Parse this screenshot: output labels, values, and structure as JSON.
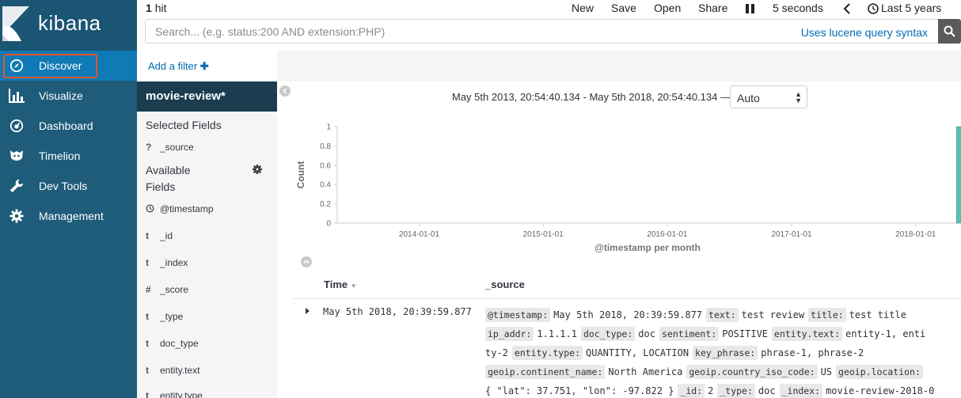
{
  "app": {
    "name": "kibana"
  },
  "nav": {
    "items": [
      {
        "label": "Discover",
        "icon": "compass-icon",
        "active": true
      },
      {
        "label": "Visualize",
        "icon": "bar-chart-icon"
      },
      {
        "label": "Dashboard",
        "icon": "dashboard-icon"
      },
      {
        "label": "Timelion",
        "icon": "timelion-icon"
      },
      {
        "label": "Dev Tools",
        "icon": "wrench-icon"
      },
      {
        "label": "Management",
        "icon": "gear-icon"
      }
    ]
  },
  "topbar": {
    "hits_count": "1",
    "hits_label": "hit",
    "menu": [
      "New",
      "Save",
      "Open",
      "Share"
    ],
    "refresh_interval": "5 seconds",
    "time_range_label": "Last 5 years"
  },
  "search": {
    "placeholder": "Search... (e.g. status:200 AND extension:PHP)",
    "value": "",
    "syntax_link": "Uses lucene query syntax"
  },
  "filter": {
    "add_label": "Add a filter"
  },
  "sidebar": {
    "index_pattern": "movie-review*",
    "selected_title": "Selected Fields",
    "selected_fields": [
      {
        "type": "?",
        "name": "_source"
      }
    ],
    "available_title_1": "Available",
    "available_title_2": "Fields",
    "available_fields": [
      {
        "type": "clock",
        "name": "@timestamp"
      },
      {
        "type": "t",
        "name": "_id"
      },
      {
        "type": "t",
        "name": "_index"
      },
      {
        "type": "#",
        "name": "_score"
      },
      {
        "type": "t",
        "name": "_type"
      },
      {
        "type": "t",
        "name": "doc_type"
      },
      {
        "type": "t",
        "name": "entity.text"
      },
      {
        "type": "t",
        "name": "entity.type"
      }
    ]
  },
  "histogram": {
    "time_range": "May 5th 2013, 20:54:40.134 - May 5th 2018, 20:54:40.134 —",
    "interval": "Auto"
  },
  "chart_data": {
    "type": "bar",
    "ylabel": "Count",
    "xlabel": "@timestamp per month",
    "ylim": [
      0,
      1
    ],
    "y_ticks": [
      "0",
      "0.2",
      "0.4",
      "0.6",
      "0.8",
      "1"
    ],
    "x_ticks": [
      "2014-01-01",
      "2015-01-01",
      "2016-01-01",
      "2017-01-01",
      "2018-01-01"
    ],
    "x_range": [
      "2013-05-05",
      "2018-05-05"
    ],
    "series": [
      {
        "values": [
          {
            "x": "2018-05-01",
            "y": 1
          }
        ]
      }
    ],
    "bar_color": "#57c1b4",
    "grid": false
  },
  "table": {
    "col_time": "Time",
    "col_source": "_source",
    "rows": [
      {
        "time": "May 5th 2018, 20:39:59.877",
        "source_lines": [
          [
            [
              "@timestamp:",
              "May 5th 2018, 20:39:59.877"
            ],
            [
              "text:",
              "test review"
            ],
            [
              "title:",
              "test title"
            ]
          ],
          [
            [
              "ip_addr:",
              "1.1.1.1"
            ],
            [
              "doc_type:",
              "doc"
            ],
            [
              "sentiment:",
              "POSITIVE"
            ],
            [
              "entity.text:",
              "entity-1, enti"
            ]
          ],
          [
            [
              "",
              "ty-2"
            ],
            [
              "entity.type:",
              "QUANTITY, LOCATION"
            ],
            [
              "key_phrase:",
              "phrase-1, phrase-2"
            ]
          ],
          [
            [
              "geoip.continent_name:",
              "North America"
            ],
            [
              "geoip.country_iso_code:",
              "US"
            ],
            [
              "geoip.location:",
              ""
            ]
          ],
          [
            [
              "",
              "{ \"lat\": 37.751, \"lon\": -97.822 }"
            ],
            [
              "_id:",
              "2"
            ],
            [
              "_type:",
              "doc"
            ],
            [
              "_index:",
              "movie-review-2018-0"
            ]
          ]
        ]
      }
    ]
  }
}
